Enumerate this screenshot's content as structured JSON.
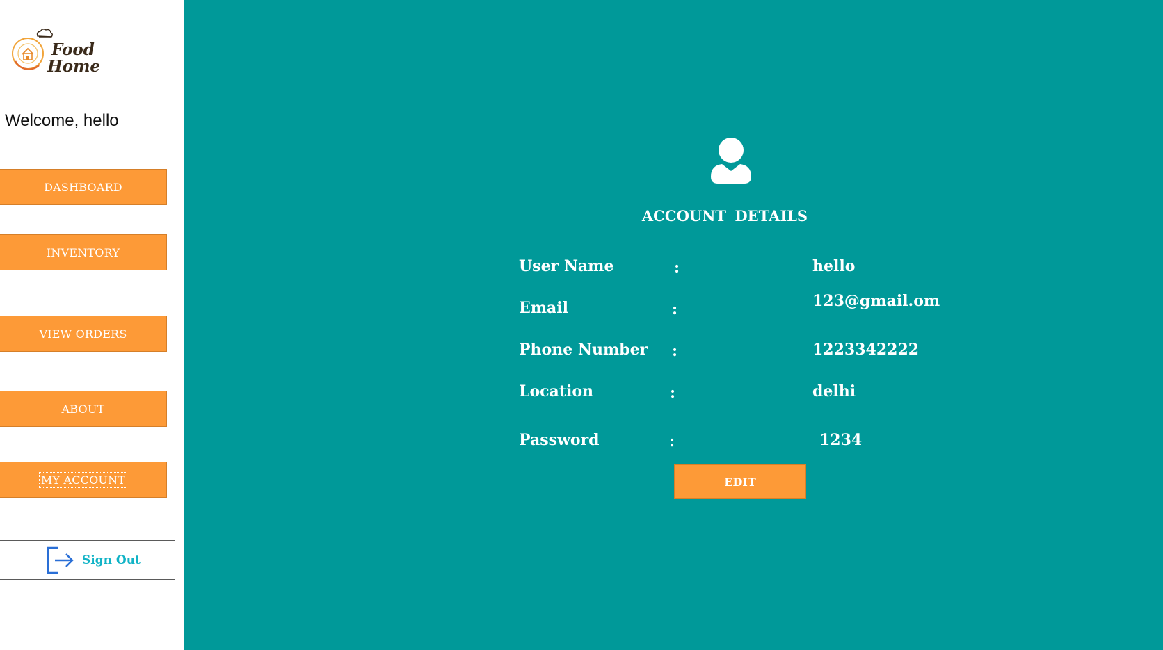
{
  "window": {
    "title": ""
  },
  "sidebar": {
    "logo": {
      "line1": "Food",
      "line2": "Home"
    },
    "welcome": "Welcome, hello",
    "items": [
      {
        "label": "DASHBOARD"
      },
      {
        "label": "INVENTORY"
      },
      {
        "label": "VIEW ORDERS"
      },
      {
        "label": "ABOUT"
      },
      {
        "label": "MY ACCOUNT",
        "focused": true
      }
    ],
    "signout": {
      "label": "Sign Out",
      "icon": "sign-out-icon"
    }
  },
  "main": {
    "avatar_icon": "user-icon",
    "title": "ACCOUNT  DETAILS",
    "fields": [
      {
        "label": "User  Name",
        "colon": ":",
        "value": "hello"
      },
      {
        "label": "Email",
        "colon": ":",
        "value": "123@gmail.om"
      },
      {
        "label": "Phone Number",
        "colon": ":",
        "value": "1223342222"
      },
      {
        "label": "Location",
        "colon": ":",
        "value": "delhi"
      },
      {
        "label": "Password",
        "colon": ":",
        "value": "1234"
      }
    ],
    "edit_label": "EDIT"
  },
  "colors": {
    "main_bg": "#009999",
    "button_orange": "#fd9a37",
    "signout_text": "#11b3c6",
    "signout_icon": "#2a6fd6",
    "logo_text": "#3a2a1a"
  }
}
